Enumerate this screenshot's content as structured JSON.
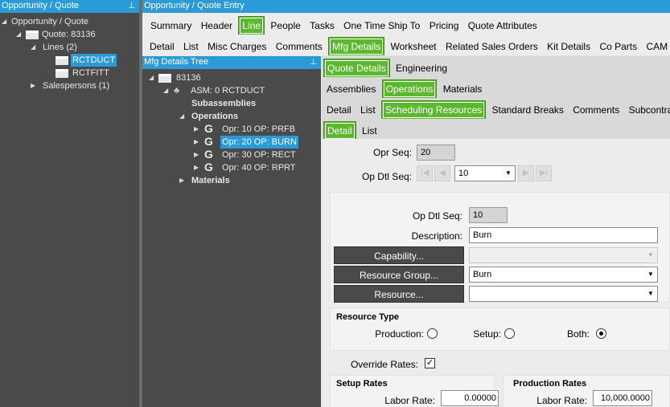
{
  "left_panel": {
    "title": "Opportunity / Quote",
    "tree": {
      "root": "Opportunity / Quote",
      "quote": "Quote: 83136",
      "lines": "Lines (2)",
      "line1": "RCTDUCT",
      "line2": "RCTFITT",
      "salespersons": "Salespersons (1)"
    }
  },
  "window_title": "Opportunity / Quote Entry",
  "top_tabs": [
    "Summary",
    "Header",
    "Line",
    "People",
    "Tasks",
    "One Time Ship To",
    "Pricing",
    "Quote Attributes"
  ],
  "line_tabs": [
    "Detail",
    "List",
    "Misc Charges",
    "Comments",
    "Mfg Details",
    "Worksheet",
    "Related Sales Orders",
    "Kit Details",
    "Co Parts",
    "CAM Jo"
  ],
  "mfg_tree": {
    "title": "Mfg Details Tree",
    "quote": "83136",
    "asm": "ASM: 0 RCTDUCT",
    "subassemblies": "Subassemblies",
    "operations": "Operations",
    "ops": [
      "Opr: 10 OP: PRFB",
      "Opr: 20 OP: BURN",
      "Opr: 30 OP: RECT",
      "Opr: 40 OP: RPRT"
    ],
    "materials": "Materials"
  },
  "mfg_tabs": [
    "Quote Details",
    "Engineering"
  ],
  "eng_tabs": [
    "Assemblies",
    "Operations",
    "Materials"
  ],
  "op_tabs": [
    "Detail",
    "List",
    "Scheduling Resources",
    "Standard Breaks",
    "Comments",
    "Subcontract"
  ],
  "sched_tabs": [
    "Detail",
    "List"
  ],
  "form": {
    "opr_seq_label": "Opr Seq:",
    "opr_seq": "20",
    "op_dtl_seq_label": "Op Dtl Seq:",
    "op_dtl_seq_select": "10",
    "op_dtl_seq2_label": "Op Dtl Seq:",
    "op_dtl_seq2": "10",
    "description_label": "Description:",
    "description": "Burn",
    "capability_button": "Capability...",
    "capability_value": "",
    "resource_group_button": "Resource Group...",
    "resource_group_value": "Burn",
    "resource_button": "Resource...",
    "resource_value": "",
    "resource_type_title": "Resource Type",
    "production_label": "Production:",
    "setup_label": "Setup:",
    "both_label": "Both:",
    "resource_type_selected": "Both",
    "override_rates_label": "Override Rates:",
    "override_rates_checked": true,
    "setup_rates_title": "Setup Rates",
    "production_rates_title": "Production Rates",
    "setup_labor_label": "Labor Rate:",
    "setup_labor_rate": "0.00000",
    "prod_labor_label": "Labor Rate:",
    "prod_labor_rate": "10,000.0000"
  }
}
